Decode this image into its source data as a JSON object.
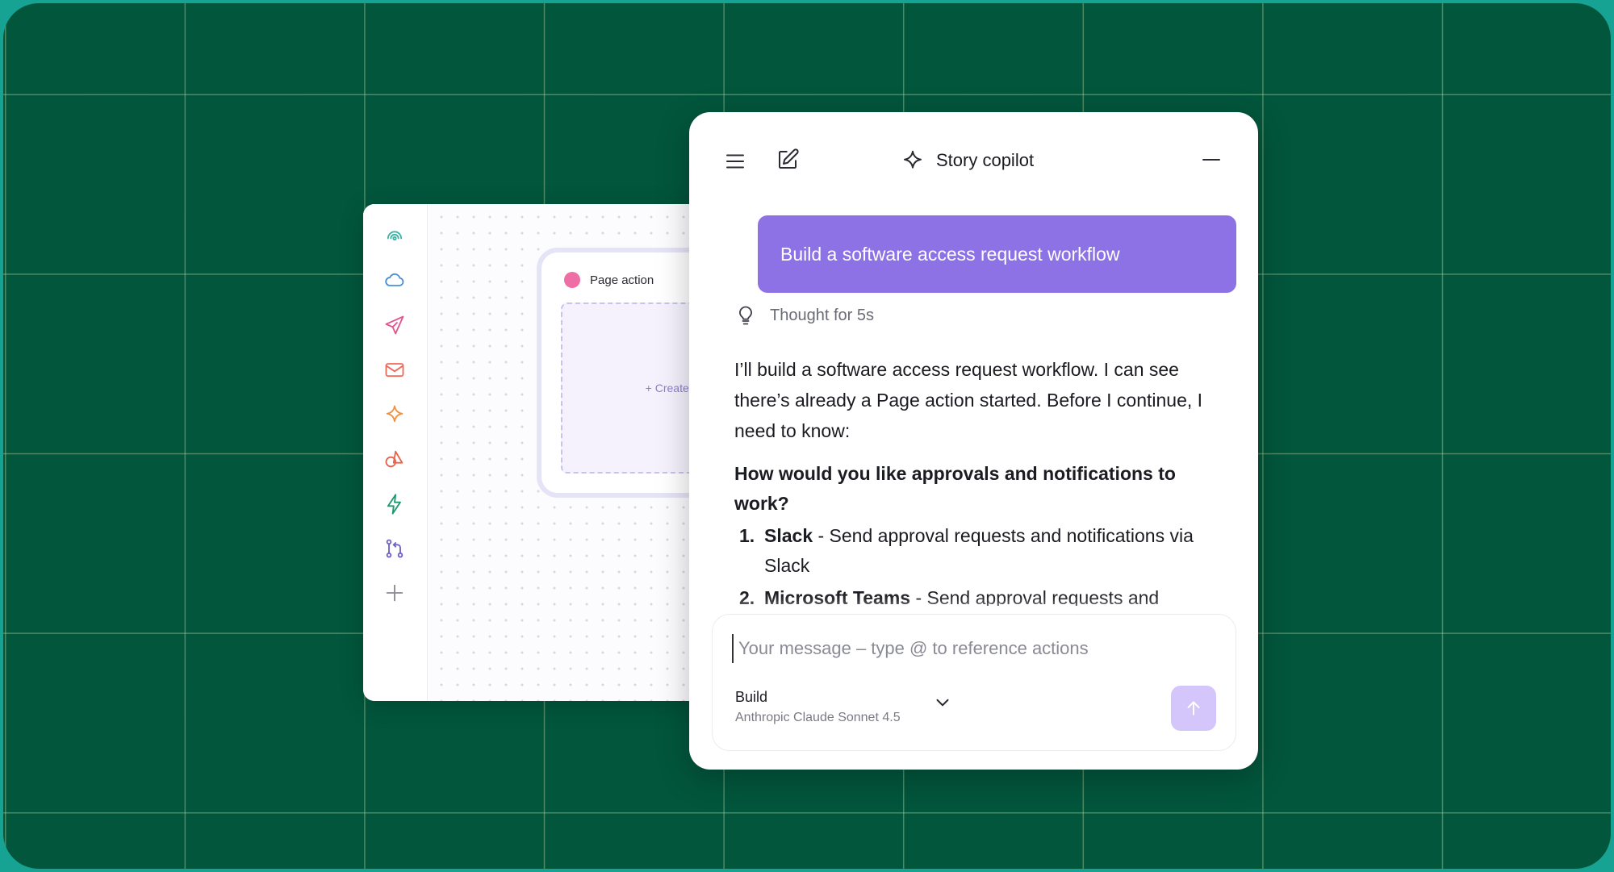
{
  "canvas": {
    "page_action": {
      "title": "Page action",
      "create_label": "+ Create Page"
    },
    "rail_icons": [
      {
        "name": "webhook-icon",
        "color": "#3bb3a6"
      },
      {
        "name": "cloud-icon",
        "color": "#4a90d9"
      },
      {
        "name": "send-icon",
        "color": "#e2568f"
      },
      {
        "name": "mail-icon",
        "color": "#ef6b5a"
      },
      {
        "name": "sparkle-icon",
        "color": "#f2913d"
      },
      {
        "name": "shapes-icon",
        "color": "#e8634d"
      },
      {
        "name": "bolt-icon",
        "color": "#1e9a6e"
      },
      {
        "name": "branch-icon",
        "color": "#6e62c9"
      },
      {
        "name": "plus-icon",
        "color": "#8a8a94"
      }
    ]
  },
  "copilot": {
    "title": "Story copilot",
    "user_message": "Build a software access request workflow",
    "thought": "Thought for 5s",
    "response": {
      "intro": "I’ll build a software access request workflow. I can see there’s already a Page action started. Before I continue, I need to know:",
      "question": "How would you like approvals and notifications to work?",
      "options": [
        {
          "number": "1.",
          "name": "Slack",
          "desc": " - Send approval requests and notifications via Slack"
        },
        {
          "number": "2.",
          "name": "Microsoft Teams",
          "desc": " - Send approval requests and notifications via Microsoft Teams"
        }
      ]
    },
    "composer": {
      "placeholder": "Your message – type @ to reference actions",
      "mode": "Build",
      "model": "Anthropic Claude Sonnet 4.5"
    },
    "colors": {
      "accent": "#8c72e4",
      "send_button": "#d4c6fa",
      "background": "#02563c"
    }
  }
}
